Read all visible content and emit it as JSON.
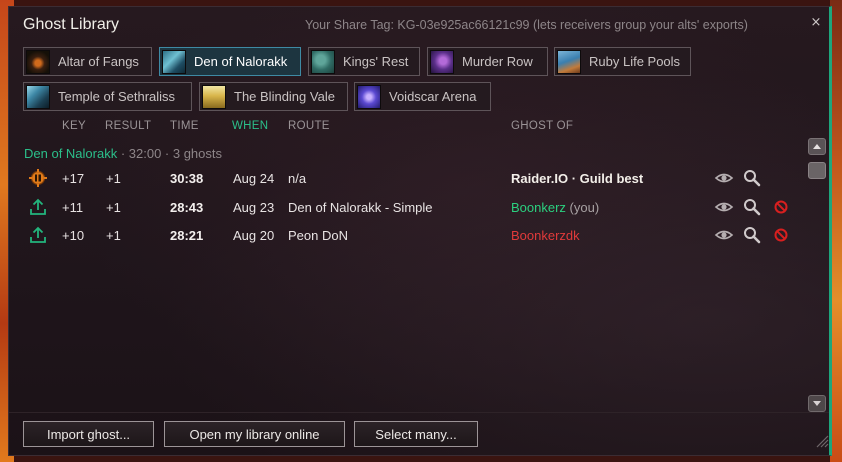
{
  "window": {
    "title": "Ghost Library",
    "share_tag": "Your Share Tag: KG-03e925ac66121c99 (lets receivers group your alts' exports)",
    "close_label": "×"
  },
  "tabs": [
    {
      "label": "Altar of Fangs",
      "icon": "altar-of-fangs-icon",
      "active": false
    },
    {
      "label": "Den of Nalorakk",
      "icon": "den-of-nalorakk-icon",
      "active": true
    },
    {
      "label": "Kings' Rest",
      "icon": "kings-rest-icon",
      "active": false
    },
    {
      "label": "Murder Row",
      "icon": "murder-row-icon",
      "active": false
    },
    {
      "label": "Ruby Life Pools",
      "icon": "ruby-life-pools-icon",
      "active": false
    },
    {
      "label": "Temple of Sethraliss",
      "icon": "temple-of-sethraliss-icon",
      "active": false
    },
    {
      "label": "The Blinding Vale",
      "icon": "blinding-vale-icon",
      "active": false
    },
    {
      "label": "Voidscar Arena",
      "icon": "voidscar-arena-icon",
      "active": false
    }
  ],
  "columns": {
    "key": "KEY",
    "result": "RESULT",
    "time": "TIME",
    "when": "WHEN",
    "route": "ROUTE",
    "ghost_of": "GHOST OF"
  },
  "group": {
    "dungeon": "Den of Nalorakk",
    "meta": " · 32:00 · 3 ghosts"
  },
  "rows": [
    {
      "icon": "raider-io-icon",
      "key": "+17",
      "result": "+1",
      "time": "30:38",
      "when": "Aug 24",
      "route": "n/a",
      "ghost": "Raider.IO · Guild best",
      "ghost_you": "",
      "ghost_color": "gold",
      "deletable": false
    },
    {
      "icon": "upload-icon",
      "key": "+11",
      "result": "+1",
      "time": "28:43",
      "when": "Aug 23",
      "route": "Den of Nalorakk - Simple",
      "ghost": "Boonkerz",
      "ghost_you": " (you)",
      "ghost_color": "green",
      "deletable": true
    },
    {
      "icon": "upload-icon",
      "key": "+10",
      "result": "+1",
      "time": "28:21",
      "when": "Aug 20",
      "route": "Peon DoN",
      "ghost": "Boonkerzdk",
      "ghost_you": "",
      "ghost_color": "red",
      "deletable": true
    }
  ],
  "footer": {
    "import_label": "Import ghost...",
    "open_online_label": "Open my library online",
    "select_many_label": "Select many..."
  },
  "colors": {
    "accent": "#2bbf8a",
    "ghost_gold": "#f3efe9",
    "ghost_green": "#2bd07f",
    "ghost_red": "#e03a3a",
    "delete_red": "#d81f1f"
  }
}
